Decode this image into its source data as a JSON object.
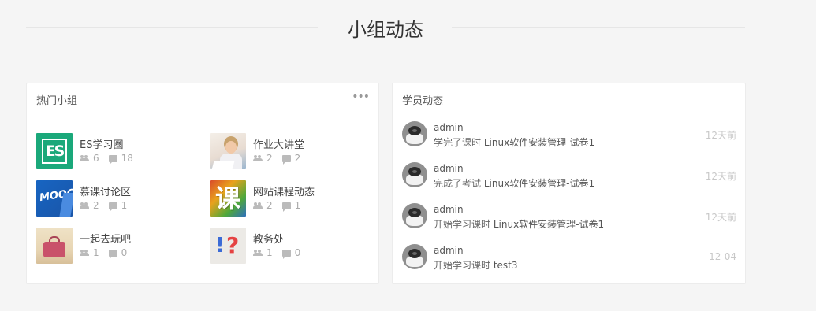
{
  "section": {
    "title": "小组动态"
  },
  "hot_groups": {
    "title": "热门小组",
    "more_icon": "ellipsis-icon",
    "items": [
      {
        "name": "ES学习圈",
        "members": "6",
        "posts": "18",
        "thumb_text": "ES"
      },
      {
        "name": "作业大讲堂",
        "members": "2",
        "posts": "2"
      },
      {
        "name": "慕课讨论区",
        "members": "2",
        "posts": "1",
        "thumb_text": "MOOC"
      },
      {
        "name": "网站课程动态",
        "members": "2",
        "posts": "1",
        "thumb_text": "课"
      },
      {
        "name": "一起去玩吧",
        "members": "1",
        "posts": "0"
      },
      {
        "name": "教务处",
        "members": "1",
        "posts": "0",
        "thumb_text": "!?"
      }
    ]
  },
  "student_activity": {
    "title": "学员动态",
    "items": [
      {
        "user": "admin",
        "action": "学完了课时",
        "target": "Linux软件安装管理-试卷1",
        "time": "12天前"
      },
      {
        "user": "admin",
        "action": "完成了考试",
        "target": "Linux软件安装管理-试卷1",
        "time": "12天前"
      },
      {
        "user": "admin",
        "action": "开始学习课时",
        "target": "Linux软件安装管理-试卷1",
        "time": "12天前"
      },
      {
        "user": "admin",
        "action": "开始学习课时",
        "target": "test3",
        "time": "12-04"
      }
    ]
  },
  "colors": {
    "accent_green": "#1aa87a",
    "time_gray": "#c8c8c8"
  }
}
